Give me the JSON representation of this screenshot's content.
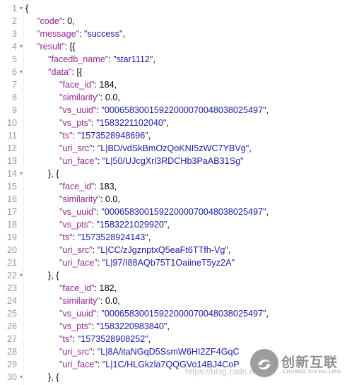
{
  "editor": {
    "lines": [
      {
        "num": "1",
        "fold": "▾",
        "indent": 0,
        "tokens": [
          {
            "t": "{",
            "c": "p"
          }
        ]
      },
      {
        "num": "2",
        "fold": "",
        "indent": 1,
        "tokens": [
          {
            "t": "\"code\"",
            "c": "k"
          },
          {
            "t": ": 0,",
            "c": "n"
          }
        ]
      },
      {
        "num": "3",
        "fold": "",
        "indent": 1,
        "tokens": [
          {
            "t": "\"message\"",
            "c": "k"
          },
          {
            "t": ": ",
            "c": "p"
          },
          {
            "t": "\"success\"",
            "c": "s"
          },
          {
            "t": ",",
            "c": "p"
          }
        ]
      },
      {
        "num": "4",
        "fold": "▾",
        "indent": 1,
        "tokens": [
          {
            "t": "\"result\"",
            "c": "k"
          },
          {
            "t": ": [{",
            "c": "p"
          }
        ]
      },
      {
        "num": "5",
        "fold": "",
        "indent": 2,
        "tokens": [
          {
            "t": "\"facedb_name\"",
            "c": "k"
          },
          {
            "t": ": ",
            "c": "p"
          },
          {
            "t": "\"star1112\"",
            "c": "s"
          },
          {
            "t": ",",
            "c": "p"
          }
        ]
      },
      {
        "num": "6",
        "fold": "▾",
        "indent": 2,
        "tokens": [
          {
            "t": "\"data\"",
            "c": "k"
          },
          {
            "t": ": [{",
            "c": "p"
          }
        ]
      },
      {
        "num": "7",
        "fold": "",
        "indent": 3,
        "tokens": [
          {
            "t": "\"face_id\"",
            "c": "k"
          },
          {
            "t": ": 184,",
            "c": "n"
          }
        ]
      },
      {
        "num": "8",
        "fold": "",
        "indent": 3,
        "tokens": [
          {
            "t": "\"similarity\"",
            "c": "k"
          },
          {
            "t": ": 0.0,",
            "c": "n"
          }
        ]
      },
      {
        "num": "9",
        "fold": "",
        "indent": 3,
        "tokens": [
          {
            "t": "\"vs_uuid\"",
            "c": "k"
          },
          {
            "t": ": ",
            "c": "p"
          },
          {
            "t": "\"00065830015922000070048038025497\"",
            "c": "s"
          },
          {
            "t": ",",
            "c": "p"
          }
        ]
      },
      {
        "num": "10",
        "fold": "",
        "indent": 3,
        "tokens": [
          {
            "t": "\"vs_pts\"",
            "c": "k"
          },
          {
            "t": ": ",
            "c": "p"
          },
          {
            "t": "\"1583221102040\"",
            "c": "s"
          },
          {
            "t": ",",
            "c": "p"
          }
        ]
      },
      {
        "num": "11",
        "fold": "",
        "indent": 3,
        "tokens": [
          {
            "t": "\"ts\"",
            "c": "k"
          },
          {
            "t": ": ",
            "c": "p"
          },
          {
            "t": "\"1573528948696\"",
            "c": "s"
          },
          {
            "t": ",",
            "c": "p"
          }
        ]
      },
      {
        "num": "12",
        "fold": "",
        "indent": 3,
        "tokens": [
          {
            "t": "\"uri_src\"",
            "c": "k"
          },
          {
            "t": ": ",
            "c": "p"
          },
          {
            "t": "\"L|BD/vdSkBmOzQoKNI5zWC7YBVg\"",
            "c": "s"
          },
          {
            "t": ",",
            "c": "p"
          }
        ]
      },
      {
        "num": "13",
        "fold": "",
        "indent": 3,
        "tokens": [
          {
            "t": "\"uri_face\"",
            "c": "k"
          },
          {
            "t": ": ",
            "c": "p"
          },
          {
            "t": "\"L|50/UJcgXrl3RDCHb3PaAB31Sg\"",
            "c": "s"
          }
        ]
      },
      {
        "num": "14",
        "fold": "▾",
        "indent": 2,
        "tokens": [
          {
            "t": "}, {",
            "c": "p"
          }
        ]
      },
      {
        "num": "15",
        "fold": "",
        "indent": 3,
        "tokens": [
          {
            "t": "\"face_id\"",
            "c": "k"
          },
          {
            "t": ": 183,",
            "c": "n"
          }
        ]
      },
      {
        "num": "16",
        "fold": "",
        "indent": 3,
        "tokens": [
          {
            "t": "\"similarity\"",
            "c": "k"
          },
          {
            "t": ": 0.0,",
            "c": "n"
          }
        ]
      },
      {
        "num": "17",
        "fold": "",
        "indent": 3,
        "tokens": [
          {
            "t": "\"vs_uuid\"",
            "c": "k"
          },
          {
            "t": ": ",
            "c": "p"
          },
          {
            "t": "\"00065830015922000070048038025497\"",
            "c": "s"
          },
          {
            "t": ",",
            "c": "p"
          }
        ]
      },
      {
        "num": "18",
        "fold": "",
        "indent": 3,
        "tokens": [
          {
            "t": "\"vs_pts\"",
            "c": "k"
          },
          {
            "t": ": ",
            "c": "p"
          },
          {
            "t": "\"1583221029920\"",
            "c": "s"
          },
          {
            "t": ",",
            "c": "p"
          }
        ]
      },
      {
        "num": "19",
        "fold": "",
        "indent": 3,
        "tokens": [
          {
            "t": "\"ts\"",
            "c": "k"
          },
          {
            "t": ": ",
            "c": "p"
          },
          {
            "t": "\"1573528924143\"",
            "c": "s"
          },
          {
            "t": ",",
            "c": "p"
          }
        ]
      },
      {
        "num": "20",
        "fold": "",
        "indent": 3,
        "tokens": [
          {
            "t": "\"uri_src\"",
            "c": "k"
          },
          {
            "t": ": ",
            "c": "p"
          },
          {
            "t": "\"L|CC/zJgznptxQ5eaFt6TTfh-Vg\"",
            "c": "s"
          },
          {
            "t": ",",
            "c": "p"
          }
        ]
      },
      {
        "num": "21",
        "fold": "",
        "indent": 3,
        "tokens": [
          {
            "t": "\"uri_face\"",
            "c": "k"
          },
          {
            "t": ": ",
            "c": "p"
          },
          {
            "t": "\"L|97/I88AQb75T1OaiineT5yz2A\"",
            "c": "s"
          }
        ]
      },
      {
        "num": "22",
        "fold": "▾",
        "indent": 2,
        "tokens": [
          {
            "t": "}, {",
            "c": "p"
          }
        ]
      },
      {
        "num": "23",
        "fold": "",
        "indent": 3,
        "tokens": [
          {
            "t": "\"face_id\"",
            "c": "k"
          },
          {
            "t": ": 182,",
            "c": "n"
          }
        ]
      },
      {
        "num": "24",
        "fold": "",
        "indent": 3,
        "tokens": [
          {
            "t": "\"similarity\"",
            "c": "k"
          },
          {
            "t": ": 0.0,",
            "c": "n"
          }
        ]
      },
      {
        "num": "25",
        "fold": "",
        "indent": 3,
        "tokens": [
          {
            "t": "\"vs_uuid\"",
            "c": "k"
          },
          {
            "t": ": ",
            "c": "p"
          },
          {
            "t": "\"00065830015922000070048038025497\"",
            "c": "s"
          },
          {
            "t": ",",
            "c": "p"
          }
        ]
      },
      {
        "num": "26",
        "fold": "",
        "indent": 3,
        "tokens": [
          {
            "t": "\"vs_pts\"",
            "c": "k"
          },
          {
            "t": ": ",
            "c": "p"
          },
          {
            "t": "\"1583220983840\"",
            "c": "s"
          },
          {
            "t": ",",
            "c": "p"
          }
        ]
      },
      {
        "num": "27",
        "fold": "",
        "indent": 3,
        "tokens": [
          {
            "t": "\"ts\"",
            "c": "k"
          },
          {
            "t": ": ",
            "c": "p"
          },
          {
            "t": "\"1573528908252\"",
            "c": "s"
          },
          {
            "t": ",",
            "c": "p"
          }
        ]
      },
      {
        "num": "28",
        "fold": "",
        "indent": 3,
        "tokens": [
          {
            "t": "\"uri_src\"",
            "c": "k"
          },
          {
            "t": ": ",
            "c": "p"
          },
          {
            "t": "\"L|8A/itaNGqD5SsmW6HI2ZF4GqC",
            "c": "s"
          }
        ]
      },
      {
        "num": "29",
        "fold": "",
        "indent": 3,
        "tokens": [
          {
            "t": "\"uri_face\"",
            "c": "k"
          },
          {
            "t": ": ",
            "c": "p"
          },
          {
            "t": "\"L|1C/HLGkzla7QQGVo14BJ4CoP",
            "c": "s"
          }
        ]
      },
      {
        "num": "30",
        "fold": "▾",
        "indent": 2,
        "tokens": [
          {
            "t": "}, {",
            "c": "p"
          }
        ]
      }
    ]
  },
  "watermark": {
    "url": "https://blog.csdn.n",
    "brand_cn": "创新互联",
    "brand_en": "CHUANG XIN HU LIAN"
  },
  "colors": {
    "key": "#92278f",
    "string": "#1a1aa6",
    "line_number": "#9a9a9a"
  },
  "icons": {
    "fold": "chevron-down-icon",
    "logo": "brand-logo-icon"
  }
}
